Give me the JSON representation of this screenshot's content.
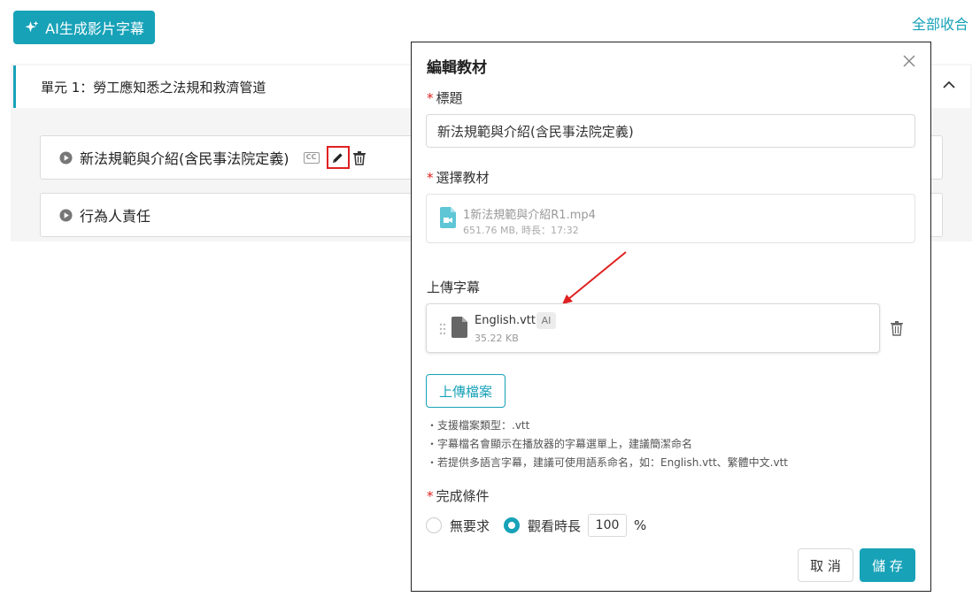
{
  "header": {
    "ai_button_label": "AI生成影片字幕",
    "collapse_all_label": "全部收合"
  },
  "unit": {
    "title": "單元 1：勞工應知悉之法規和救濟管道",
    "lessons": [
      {
        "title": "新法規範與介紹(含民事法院定義)",
        "cc_label": "CC"
      },
      {
        "title": "行為人責任"
      }
    ]
  },
  "modal": {
    "title": "編輯教材",
    "title_field": {
      "label": "標題",
      "required_mark": "*",
      "value": "新法規範與介紹(含民事法院定義)"
    },
    "material_field": {
      "label": "選擇教材",
      "required_mark": "*",
      "file_name": "1新法規範與介紹R1.mp4",
      "file_meta": "651.76 MB, 時長：17:32"
    },
    "subtitle_field": {
      "label": "上傳字幕",
      "file_name": "English.vtt",
      "badge": "AI",
      "file_size": "35.22 KB"
    },
    "upload_button_label": "上傳檔案",
    "hints": [
      "・支援檔案類型：.vtt",
      "・字幕檔名會顯示在播放器的字幕選單上，建議簡潔命名",
      "・若提供多語言字幕，建議可使用語系命名，如：English.vtt、繁體中文.vtt"
    ],
    "completion": {
      "label": "完成條件",
      "required_mark": "*",
      "option_none": "無要求",
      "option_watch": "觀看時長",
      "selected": "觀看時長",
      "percent_value": "100",
      "percent_unit": "%"
    },
    "cancel_label": "取 消",
    "save_label": "儲 存"
  },
  "colors": {
    "accent": "#17a2b8",
    "highlight": "#e02020"
  }
}
